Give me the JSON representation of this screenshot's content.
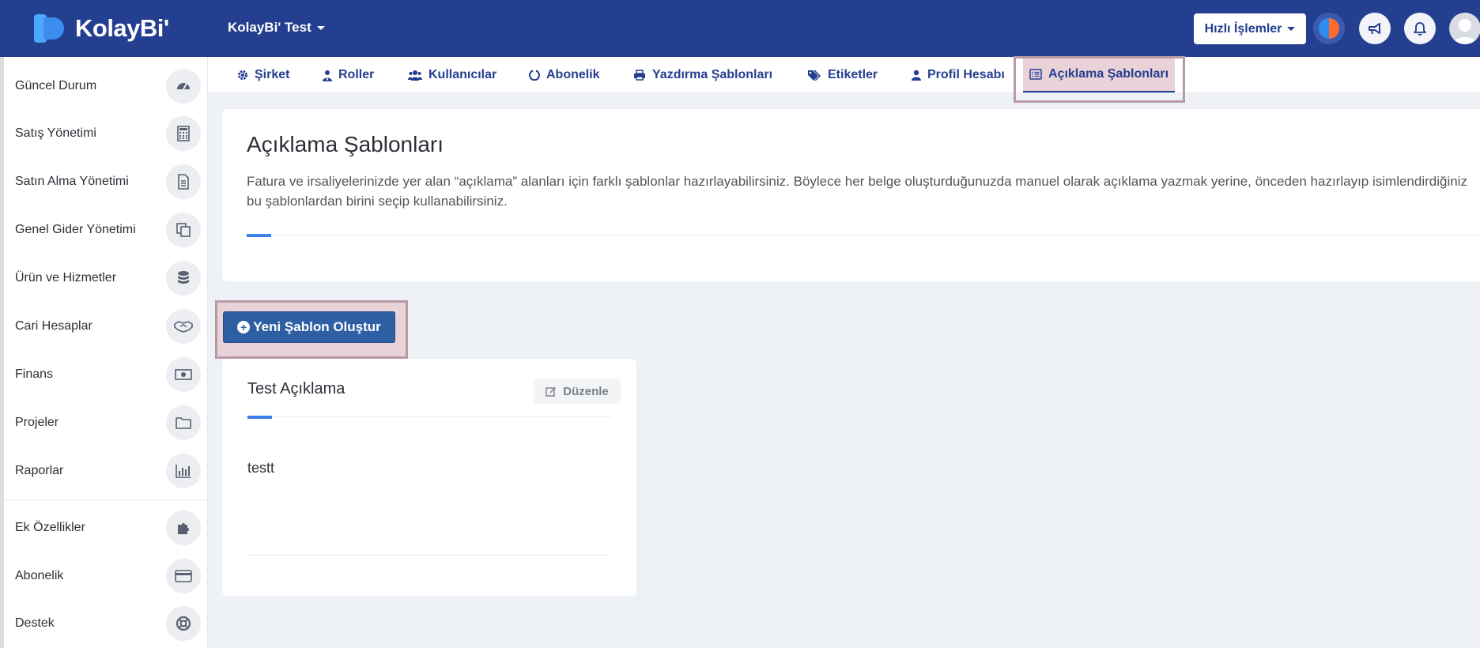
{
  "header": {
    "logo_text": "KolayBi'",
    "company_name": "KolayBi' Test",
    "quick_actions_label": "Hızlı İşlemler",
    "brand_color": "#243f8f"
  },
  "sidebar": {
    "items": [
      {
        "label": "Güncel Durum",
        "icon": "dashboard-gauge-icon"
      },
      {
        "label": "Satış Yönetimi",
        "icon": "calculator-icon"
      },
      {
        "label": "Satın Alma Yönetimi",
        "icon": "document-icon"
      },
      {
        "label": "Genel Gider Yönetimi",
        "icon": "copy-icon"
      },
      {
        "label": "Ürün ve Hizmetler",
        "icon": "database-icon"
      },
      {
        "label": "Cari Hesaplar",
        "icon": "handshake-icon"
      },
      {
        "label": "Finans",
        "icon": "money-icon"
      },
      {
        "label": "Projeler",
        "icon": "folder-icon"
      },
      {
        "label": "Raporlar",
        "icon": "bar-chart-icon"
      },
      {
        "label": "Ek Özellikler",
        "icon": "puzzle-icon"
      },
      {
        "label": "Abonelik",
        "icon": "credit-card-icon"
      },
      {
        "label": "Destek",
        "icon": "lifebuoy-icon"
      }
    ]
  },
  "tabs": [
    {
      "label": "Şirket",
      "icon": "gear-icon"
    },
    {
      "label": "Roller",
      "icon": "user-tie-icon"
    },
    {
      "label": "Kullanıcılar",
      "icon": "users-icon"
    },
    {
      "label": "Abonelik",
      "icon": "circle-notch-icon"
    },
    {
      "label": "Yazdırma Şablonları",
      "icon": "print-icon"
    },
    {
      "label": "Etiketler",
      "icon": "tags-icon"
    },
    {
      "label": "Profil Hesabı",
      "icon": "user-icon"
    },
    {
      "label": "Açıklama Şablonları",
      "icon": "list-alt-icon",
      "active": true
    }
  ],
  "info": {
    "title": "Açıklama Şablonları",
    "description": "Fatura ve irsaliyelerinizde yer alan “açıklama” alanları için farklı şablonlar hazırlayabilirsiniz. Böylece her belge oluşturduğunuzda manuel olarak açıklama yazmak yerine, önceden hazırlayıp isimlendirdiğiniz bu şablonlardan birini seçip kullanabilirsiniz."
  },
  "actions": {
    "new_template_label": "Yeni Şablon Oluştur"
  },
  "templates": [
    {
      "title": "Test Açıklama",
      "edit_label": "Düzenle",
      "body": "testt"
    }
  ]
}
